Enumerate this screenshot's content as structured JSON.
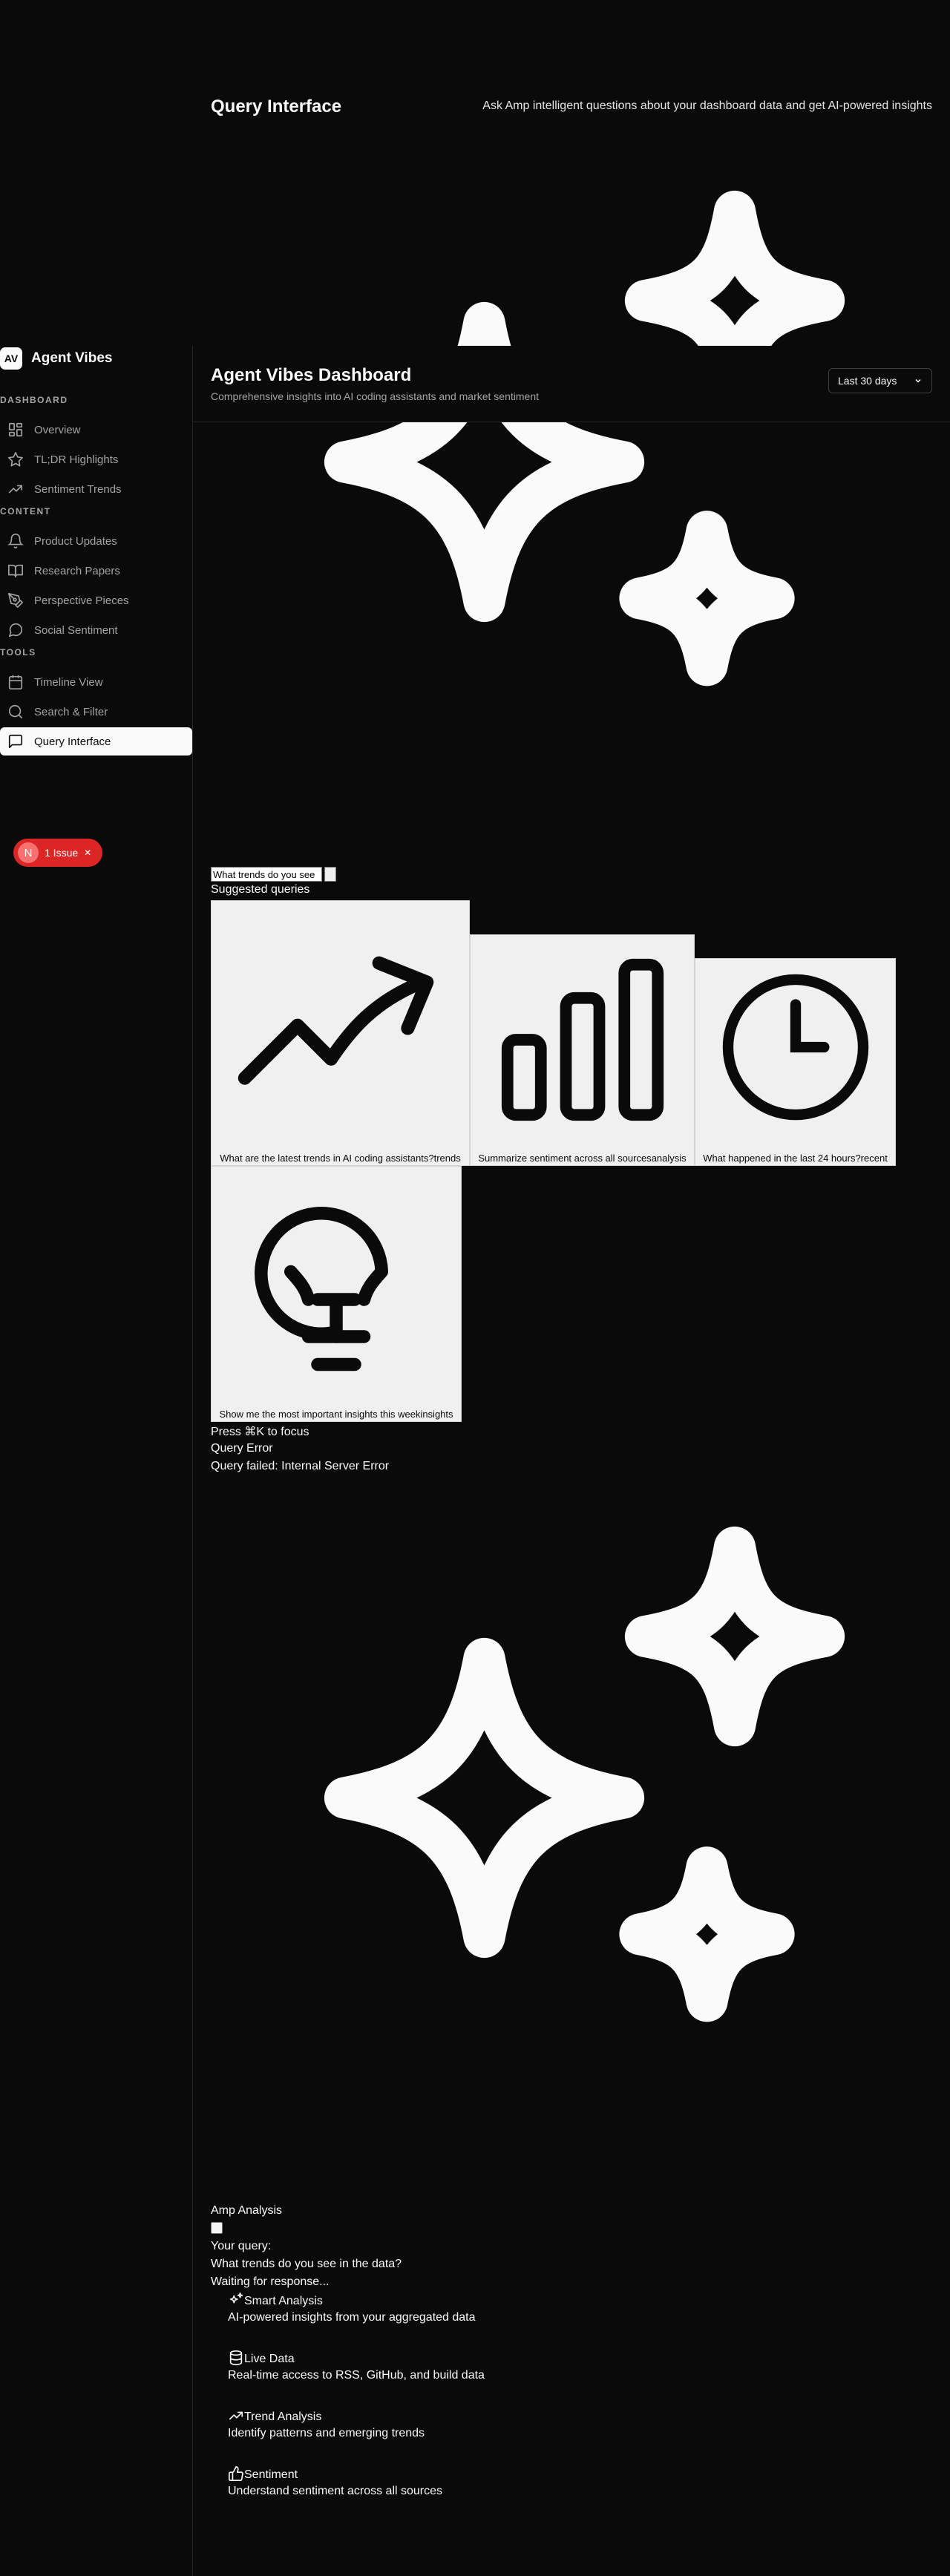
{
  "page": {
    "title": "Query Interface",
    "tagline": "Ask Amp intelligent questions about your dashboard data and get AI-powered insights"
  },
  "sidebar": {
    "logo_initials": "AV",
    "app_name": "Agent Vibes",
    "sections": [
      {
        "label": "DASHBOARD",
        "items": [
          {
            "label": "Overview",
            "icon": "grid-icon"
          },
          {
            "label": "TL;DR Highlights",
            "icon": "star-icon"
          },
          {
            "label": "Sentiment Trends",
            "icon": "trending-up-icon"
          }
        ]
      },
      {
        "label": "CONTENT",
        "items": [
          {
            "label": "Product Updates",
            "icon": "bell-icon"
          },
          {
            "label": "Research Papers",
            "icon": "book-icon"
          },
          {
            "label": "Perspective Pieces",
            "icon": "pen-nib-icon"
          },
          {
            "label": "Social Sentiment",
            "icon": "chat-bubble-icon"
          }
        ]
      },
      {
        "label": "TOOLS",
        "items": [
          {
            "label": "Timeline View",
            "icon": "calendar-icon"
          },
          {
            "label": "Search & Filter",
            "icon": "search-icon"
          },
          {
            "label": "Query Interface",
            "icon": "message-square-icon",
            "active": true
          }
        ]
      }
    ]
  },
  "header": {
    "title": "Agent Vibes Dashboard",
    "subtitle": "Comprehensive insights into AI coding assistants and market sentiment",
    "range": "Last 30 days"
  },
  "issues_badge": {
    "initial": "N",
    "label": "1 Issue",
    "close": "✕"
  },
  "query": {
    "input_value": "What trends do you see",
    "suggested_title": "Suggested queries",
    "suggestions": [
      {
        "text": "What are the latest trends in AI coding assistants?",
        "tag": "trends",
        "icon": "trending-up-icon"
      },
      {
        "text": "Summarize sentiment across all sources",
        "tag": "analysis",
        "icon": "bar-chart-icon"
      },
      {
        "text": "What happened in the last 24 hours?",
        "tag": "recent",
        "icon": "clock-icon"
      },
      {
        "text": "Show me the most important insights this week",
        "tag": "insights",
        "icon": "lightbulb-icon"
      }
    ],
    "focus_hint": "Press ⌘K to focus",
    "error_title": "Query Error",
    "error_message": "Query failed: Internal Server Error"
  },
  "analysis": {
    "title": "Amp Analysis",
    "your_query_label": "Your query:",
    "your_query": "What trends do you see in the data?",
    "status": "Waiting for response...",
    "features": [
      {
        "title": "Smart Analysis",
        "desc": "AI-powered insights from your aggregated data",
        "icon": "sparkles-icon"
      },
      {
        "title": "Live Data",
        "desc": "Real-time access to RSS, GitHub, and build data",
        "icon": "database-icon"
      },
      {
        "title": "Trend Analysis",
        "desc": "Identify patterns and emerging trends",
        "icon": "trending-up-icon"
      },
      {
        "title": "Sentiment",
        "desc": "Understand sentiment across all sources",
        "icon": "thumbs-up-icon"
      }
    ]
  }
}
